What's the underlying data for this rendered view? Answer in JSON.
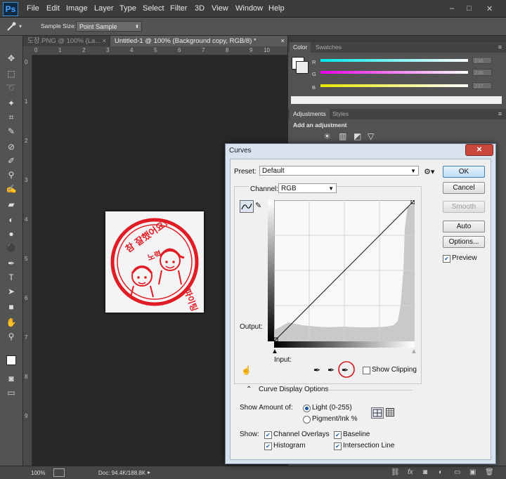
{
  "app": {
    "logo": "Ps",
    "menus": [
      "File",
      "Edit",
      "Image",
      "Layer",
      "Type",
      "Select",
      "Filter",
      "3D",
      "View",
      "Window",
      "Help"
    ],
    "window_controls": [
      "–",
      "□",
      "✕"
    ]
  },
  "options_bar": {
    "tool_icon": "eyedropper-icon",
    "sample_size_label": "Sample Size:",
    "sample_size_value": "Point Sample"
  },
  "tabs": [
    {
      "label": "도장.PNG @ 100% (La...",
      "close": "×"
    },
    {
      "label": "Untitled-1 @ 100% (Background copy, RGB/8) *",
      "close": "×"
    }
  ],
  "ruler": {
    "h_ticks": [
      "0",
      "1",
      "2",
      "3",
      "4",
      "5",
      "6",
      "7",
      "8",
      "9",
      "10"
    ],
    "v_ticks": [
      "0",
      "1",
      "2",
      "3",
      "4",
      "5",
      "6",
      "7",
      "8",
      "9"
    ]
  },
  "status": {
    "zoom": "100%",
    "doc": "Doc: 94.4K/188.8K"
  },
  "color_panel": {
    "tabs": [
      "Color",
      "Swatches"
    ],
    "r_label": "R",
    "g_label": "G",
    "b_label": "B",
    "r_value": "236",
    "g_value": "236",
    "b_value": "237"
  },
  "adjustments_panel": {
    "tabs": [
      "Adjustments",
      "Styles"
    ],
    "heading": "Add an adjustment"
  },
  "dialog": {
    "title": "Curves",
    "close": "✕",
    "preset_label": "Preset:",
    "preset_value": "Default",
    "channel_label": "Channel:",
    "channel_value": "RGB",
    "output_label": "Output:",
    "input_label": "Input:",
    "buttons": {
      "ok": "OK",
      "cancel": "Cancel",
      "smooth": "Smooth",
      "auto": "Auto",
      "options": "Options..."
    },
    "preview_label": "Preview",
    "preview_checked": true,
    "show_clipping_label": "Show Clipping",
    "show_clipping_checked": false,
    "curve_display_options": "Curve Display Options",
    "show_amount_label": "Show Amount of:",
    "light_label": "Light  (0-255)",
    "pigment_label": "Pigment/Ink %",
    "light_selected": true,
    "show_label": "Show:",
    "channel_overlays": "Channel Overlays",
    "baseline": "Baseline",
    "histogram": "Histogram",
    "intersection_line": "Intersection Line",
    "checks": {
      "channel_overlays": true,
      "baseline": true,
      "histogram": true,
      "intersection_line": true
    },
    "highlight_color": "#d0171b"
  },
  "stamp": {
    "color": "#e01d25",
    "text_top": "참 잘했어요!",
    "text_side": "파이팅",
    "text_bottom": "노력"
  }
}
